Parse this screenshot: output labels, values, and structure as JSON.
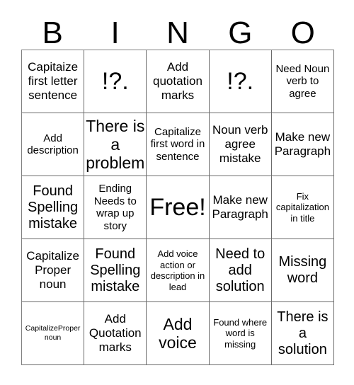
{
  "card": {
    "title": "BINGO",
    "header_letters": [
      "B",
      "I",
      "N",
      "G",
      "O"
    ],
    "grid_size": "5x5",
    "free_space_label": "Free!",
    "free_space_position": "row3-col3",
    "colors": {
      "background": "#ffffff",
      "text": "#000000",
      "grid_line": "#6b6b6b"
    },
    "rows": [
      {
        "cells": [
          {
            "text": "Capitaize first letter sentence",
            "size": "md"
          },
          {
            "text": "!?.",
            "size": "xxl"
          },
          {
            "text": "Add quotation marks",
            "size": "md"
          },
          {
            "text": "!?.",
            "size": "xxl"
          },
          {
            "text": "Need Noun verb to agree",
            "size": "sm"
          }
        ]
      },
      {
        "cells": [
          {
            "text": "Add description",
            "size": "sm"
          },
          {
            "text": "There is a problem",
            "size": "xl"
          },
          {
            "text": "Capitalize first word in sentence",
            "size": "sm"
          },
          {
            "text": "Noun verb agree mistake",
            "size": "md"
          },
          {
            "text": "Make new Paragraph",
            "size": "md"
          }
        ]
      },
      {
        "cells": [
          {
            "text": "Found Spelling mistake",
            "size": "lg"
          },
          {
            "text": "Ending Needs to wrap up story",
            "size": "sm"
          },
          {
            "text": "Free!",
            "size": "xxl"
          },
          {
            "text": "Make new Paragraph",
            "size": "md"
          },
          {
            "text": "Fix capitalization in title",
            "size": "xs"
          }
        ]
      },
      {
        "cells": [
          {
            "text": "Capitalize Proper noun",
            "size": "md"
          },
          {
            "text": "Found Spelling mistake",
            "size": "lg"
          },
          {
            "text": "Add voice action or description in lead",
            "size": "xs"
          },
          {
            "text": "Need to add solution",
            "size": "lg"
          },
          {
            "text": "Missing word",
            "size": "lg"
          }
        ]
      },
      {
        "cells": [
          {
            "text": "CapitalizeProper noun",
            "size": "xxs"
          },
          {
            "text": "Add Quotation marks",
            "size": "md"
          },
          {
            "text": "Add voice",
            "size": "xl"
          },
          {
            "text": "Found where word is missing",
            "size": "xs"
          },
          {
            "text": "There is a solution",
            "size": "lg"
          }
        ]
      }
    ]
  }
}
